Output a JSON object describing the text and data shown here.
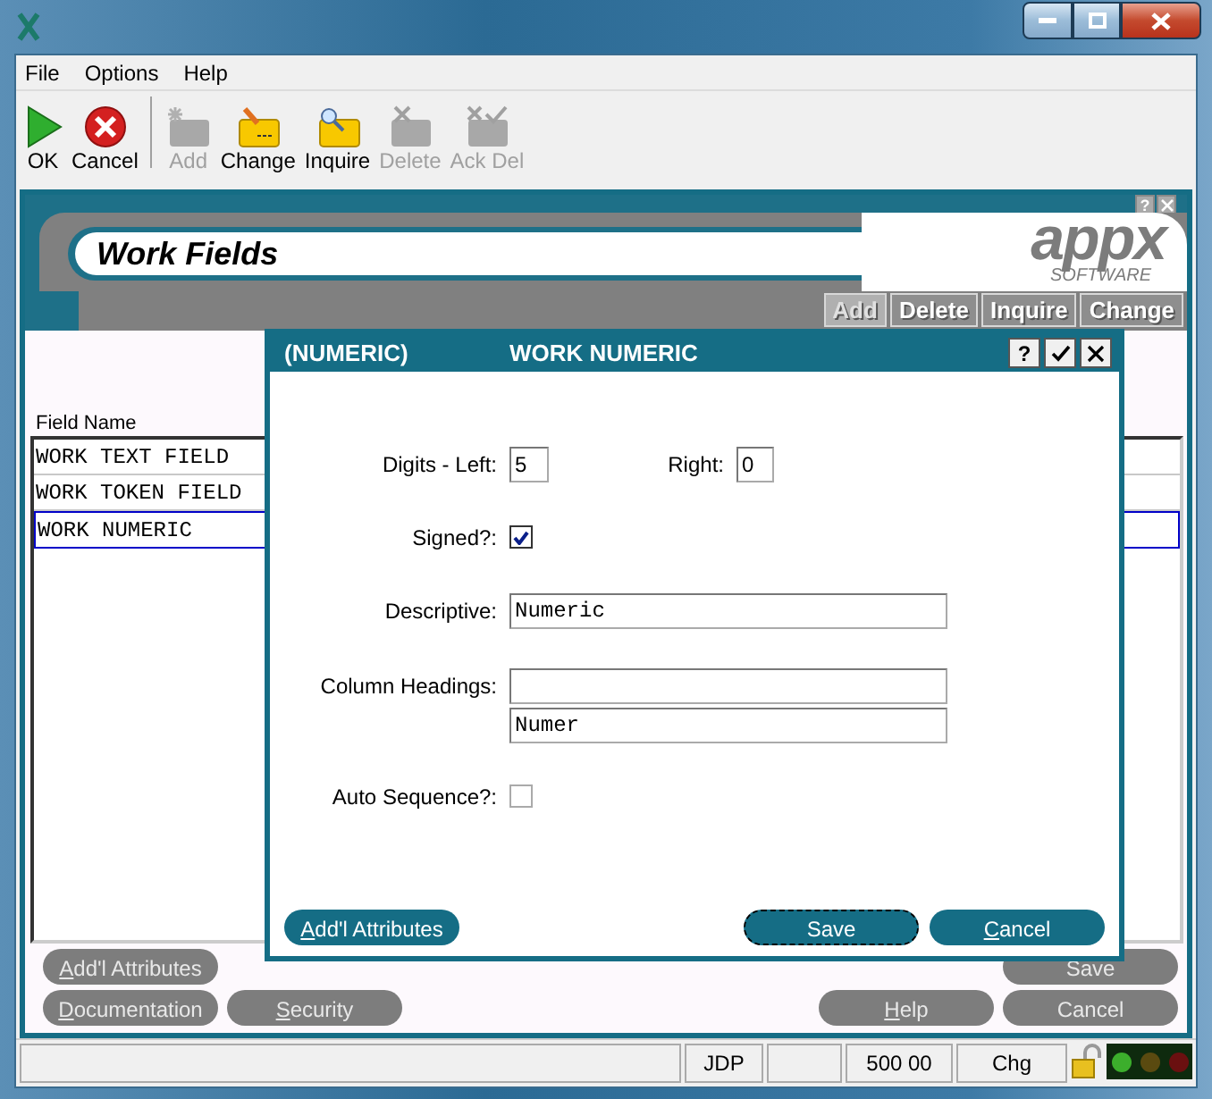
{
  "menu": [
    {
      "label": "File"
    },
    {
      "label": "Options"
    },
    {
      "label": "Help"
    }
  ],
  "toolbar": [
    {
      "kind": "ok",
      "label": "OK",
      "disabled": false
    },
    {
      "kind": "cancel",
      "label": "Cancel",
      "disabled": false
    },
    {
      "kind": "add",
      "label": "Add",
      "disabled": true
    },
    {
      "kind": "change",
      "label": "Change",
      "disabled": false
    },
    {
      "kind": "inquire",
      "label": "Inquire",
      "disabled": false
    },
    {
      "kind": "delete",
      "label": "Delete",
      "disabled": true
    },
    {
      "kind": "ack",
      "label": "Ack Del",
      "disabled": true
    }
  ],
  "screen": {
    "title": "Work Fields",
    "logo": {
      "name": "appx",
      "tagline": "SOFTWARE"
    },
    "corner_buttons": [
      "?"
    ],
    "mode_buttons": [
      {
        "label": "Add",
        "disabled": true
      },
      {
        "label": "Delete",
        "disabled": false
      },
      {
        "label": "Inquire",
        "disabled": false
      },
      {
        "label": "Change",
        "disabled": false
      }
    ],
    "list": {
      "column": "Field Name",
      "rows": [
        {
          "name": "WORK TEXT FIELD",
          "selected": false
        },
        {
          "name": "WORK TOKEN FIELD",
          "selected": false
        },
        {
          "name": "WORK NUMERIC",
          "selected": true
        }
      ]
    },
    "buttons_left": [
      [
        {
          "label": "Add'l Attributes",
          "mnemonic": true
        }
      ],
      [
        {
          "label": "Documentation",
          "mnemonic": true
        },
        {
          "label": "Security",
          "mnemonic": true
        }
      ]
    ],
    "buttons_right": [
      [
        {
          "label": "Save",
          "mnemonic": false
        }
      ],
      [
        {
          "label": "Help",
          "mnemonic": true
        },
        {
          "label": "Cancel",
          "mnemonic": false
        }
      ]
    ]
  },
  "dialog": {
    "type": "(NUMERIC)",
    "title": "WORK NUMERIC",
    "help": "?",
    "digits_left": {
      "label": "Digits - Left:",
      "value": "5"
    },
    "digits_right": {
      "label": "Right:",
      "value": "0"
    },
    "signed": {
      "label": "Signed?:",
      "checked": true
    },
    "descriptive": {
      "label": "Descriptive:",
      "value": "Numeric"
    },
    "column_headings": {
      "label": "Column Headings:",
      "second_line": "Numer"
    },
    "auto_sequence": {
      "label": "Auto Sequence?:",
      "checked": false
    },
    "buttons": [
      {
        "label": "Add'l Attributes",
        "mnemonic": true,
        "focused": false
      },
      {
        "label": "Save",
        "mnemonic": false,
        "focused": true
      },
      {
        "label": "Cancel",
        "mnemonic": true,
        "focused": false
      }
    ]
  },
  "status_bar": {
    "cells": [
      {
        "text": "JDP"
      },
      {
        "text": ""
      },
      {
        "text": "500 00"
      },
      {
        "text": "Chg"
      }
    ]
  }
}
